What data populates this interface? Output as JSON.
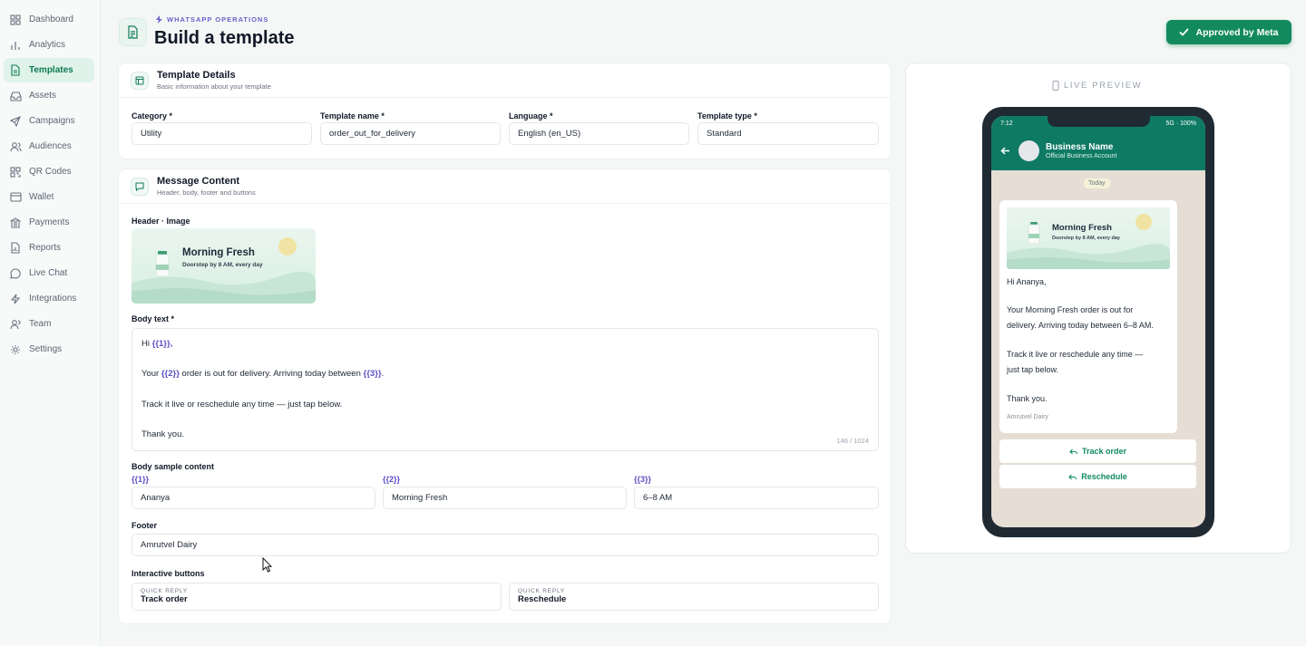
{
  "sidebar": {
    "items": [
      {
        "label": "Dashboard",
        "icon": "grid-icon"
      },
      {
        "label": "Analytics",
        "icon": "bar-chart-icon"
      },
      {
        "label": "Templates",
        "icon": "document-icon",
        "active": true
      },
      {
        "label": "Assets",
        "icon": "inbox-icon"
      },
      {
        "label": "Campaigns",
        "icon": "send-icon"
      },
      {
        "label": "Audiences",
        "icon": "users-icon"
      },
      {
        "label": "QR Codes",
        "icon": "qr-icon"
      },
      {
        "label": "Wallet",
        "icon": "card-icon"
      },
      {
        "label": "Payments",
        "icon": "bank-icon"
      },
      {
        "label": "Reports",
        "icon": "report-icon"
      },
      {
        "label": "Live Chat",
        "icon": "chat-icon"
      },
      {
        "label": "Integrations",
        "icon": "bolt-icon"
      },
      {
        "label": "Team",
        "icon": "team-icon"
      },
      {
        "label": "Settings",
        "icon": "gear-icon"
      }
    ]
  },
  "header": {
    "kicker": "WHATSAPP OPERATIONS",
    "title": "Build a template",
    "approved_label": "Approved by Meta"
  },
  "details": {
    "title": "Template Details",
    "subtitle": "Basic information about your template",
    "category_label": "Category *",
    "category_value": "Utility",
    "name_label": "Template name *",
    "name_value": "order_out_for_delivery",
    "language_label": "Language *",
    "language_value": "English (en_US)",
    "type_label": "Template type *",
    "type_value": "Standard"
  },
  "message": {
    "title": "Message Content",
    "subtitle": "Header, body, footer and buttons",
    "header_label": "Header · Image",
    "image_title": "Morning Fresh",
    "image_subtitle": "Doorstep by 8 AM, every day",
    "body_label": "Body text *",
    "body": {
      "l1a": "Hi ",
      "v1": "{{1}}",
      "l1b": ",",
      "l2a": "Your ",
      "v2": "{{2}}",
      "l2b": " order is out for delivery. Arriving today between ",
      "v3": "{{3}}",
      "l2c": ".",
      "l3": "Track it live or reschedule any time — just tap below.",
      "l4": "Thank you."
    },
    "char_count": "146 / 1024",
    "sample_label": "Body sample content",
    "samples": [
      {
        "var": "{{1}}",
        "value": "Ananya"
      },
      {
        "var": "{{2}}",
        "value": "Morning Fresh"
      },
      {
        "var": "{{3}}",
        "value": "6–8 AM"
      }
    ],
    "footer_label": "Footer",
    "footer_value": "Amrutvel Dairy",
    "buttons_label": "Interactive buttons",
    "buttons": [
      {
        "kind": "QUICK REPLY",
        "label": "Track order"
      },
      {
        "kind": "QUICK REPLY",
        "label": "Reschedule"
      }
    ]
  },
  "preview": {
    "label": "LIVE PREVIEW",
    "time": "7:12",
    "network": "5G · 100%",
    "business_name": "Business Name",
    "business_sub": "Official Business Account",
    "today": "Today",
    "image_title": "Morning Fresh",
    "image_subtitle": "Doorstep by 8 AM, every day",
    "greeting": "Hi Ananya,",
    "p1a": "Your Morning Fresh order is out for",
    "p1b": "delivery. Arriving today between 6–8 AM.",
    "p2a": "Track it live or reschedule any time —",
    "p2b": "just tap below.",
    "thanks": "Thank you.",
    "footer": "Amrutvel Dairy",
    "btn1": "Track order",
    "btn2": "Reschedule"
  }
}
